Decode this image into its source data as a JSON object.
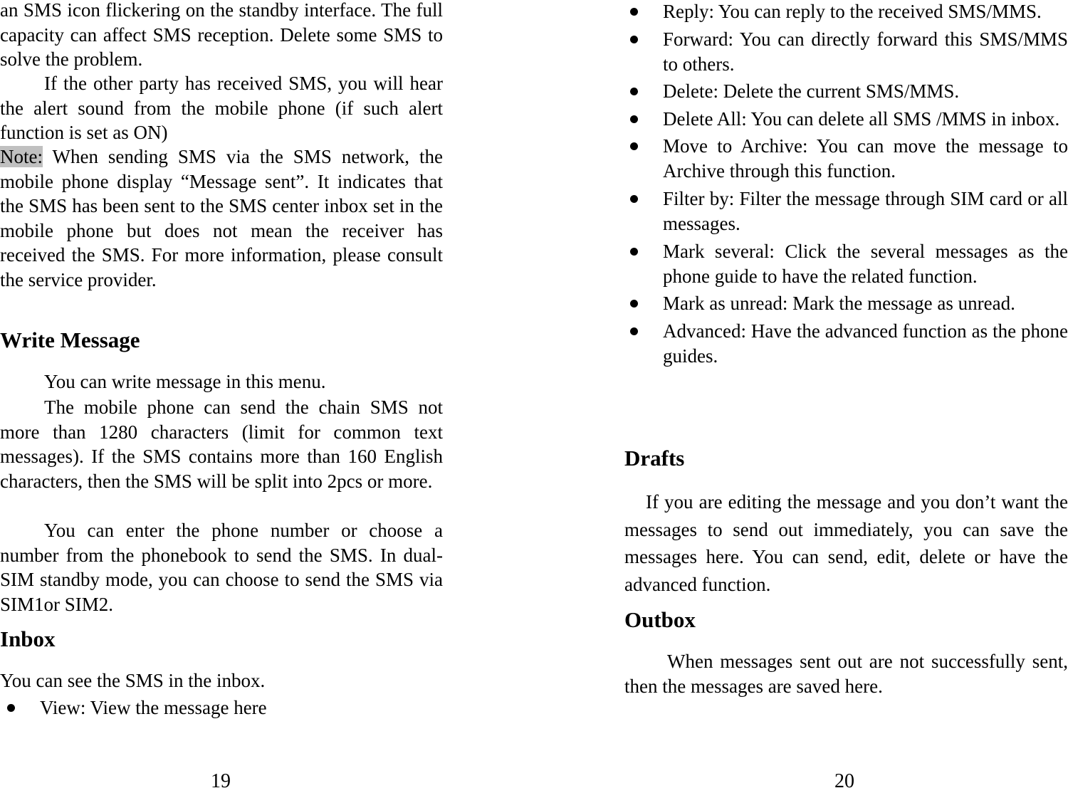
{
  "left": {
    "p1": "an SMS icon flickering on the standby interface. The full capacity can affect SMS reception. Delete some SMS to solve the problem.",
    "p2": "If the other party has received SMS, you will hear the alert sound from the mobile phone (if such alert function is set as ON)",
    "note_label": "Note:",
    "p3": " When sending SMS via the SMS network, the mobile phone display “Message sent”. It indicates that the SMS has been sent to the SMS center inbox set in the mobile phone but does not mean the receiver has received the SMS. For more information, please consult the service provider.",
    "h_write": "Write Message",
    "p4": "You can write message in this menu.",
    "p5": "The mobile phone can send the chain SMS not more than 1280 characters (limit for common text messages). If the SMS contains more than 160 English characters, then the SMS will be split into 2pcs or more.",
    "p6": "You can enter the phone number or choose a number from the phonebook to send the SMS. In dual-SIM standby mode, you can choose to send the SMS via SIM1or SIM2.",
    "h_inbox": "Inbox",
    "p7": "You can see the SMS in the inbox.",
    "bullets": [
      "View: View the message here"
    ],
    "page_number": "19"
  },
  "right": {
    "bullets": [
      "Reply: You can reply to the received SMS/MMS.",
      "Forward: You can directly forward this SMS/MMS to others.",
      "Delete: Delete the current SMS/MMS.",
      "Delete All: You can delete all SMS /MMS in inbox.",
      "Move to Archive: You can move the message to Archive through this function.",
      "Filter by: Filter the message through SIM card or all messages.",
      "Mark several: Click the several messages as the phone guide to have the related function.",
      "Mark as unread: Mark the message as unread.",
      "Advanced: Have the advanced function as the phone guides."
    ],
    "h_drafts": "Drafts",
    "p_drafts": "If you are editing the message and you don’t want the messages to send out immediately, you can save the messages here. You can send, edit, delete or have the advanced function.",
    "h_outbox": "Outbox",
    "p_outbox": "When messages sent out are not successfully sent, then the messages are saved here.",
    "page_number": "20"
  },
  "colors": {
    "note_highlight": "#c0c0c0"
  }
}
